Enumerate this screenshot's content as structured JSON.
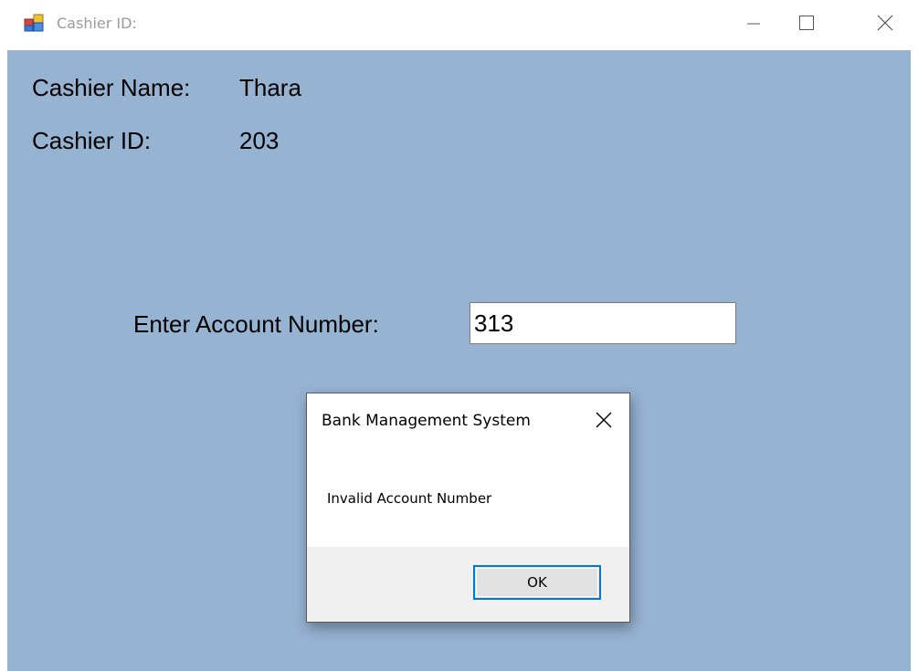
{
  "window": {
    "title": "Cashier ID:",
    "icon": "app-form-icon",
    "controls": {
      "minimize": "minimize-icon",
      "maximize": "maximize-icon",
      "close": "close-icon"
    }
  },
  "form": {
    "cashier_name_label": "Cashier Name:",
    "cashier_name_value": "Thara",
    "cashier_id_label": "Cashier ID:",
    "cashier_id_value": "203",
    "account_label": "Enter Account Number:",
    "account_value": "313"
  },
  "dialog": {
    "title": "Bank Management System",
    "message": "Invalid Account Number",
    "ok_label": "OK",
    "close_icon": "close-icon"
  },
  "colors": {
    "client_background": "#97b3d2",
    "ok_focus_border": "#0078d7",
    "dialog_footer": "#f0f0f0"
  }
}
